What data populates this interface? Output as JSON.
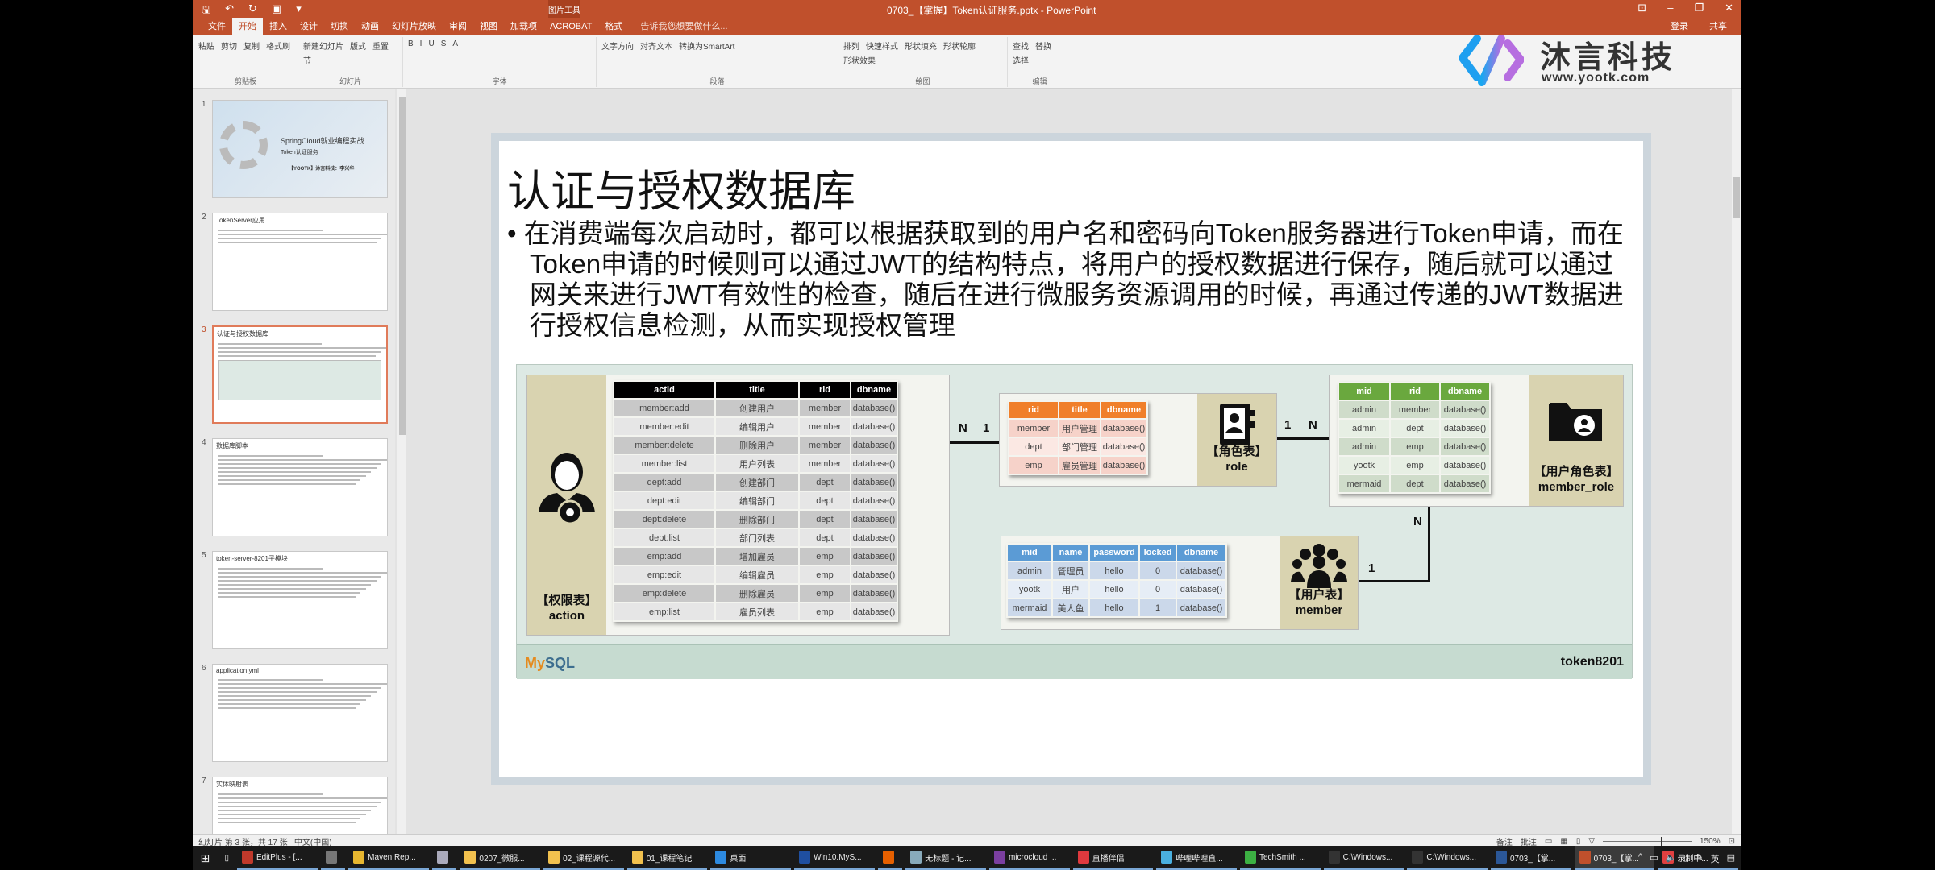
{
  "titlebar": {
    "title": "0703_【掌握】Token认证服务.pptx - PowerPoint",
    "context_tool": "图片工具",
    "qat": [
      "save-icon",
      "undo-icon",
      "redo-icon",
      "present-icon",
      "customize-icon"
    ]
  },
  "tabs": [
    "文件",
    "开始",
    "插入",
    "设计",
    "切换",
    "动画",
    "幻灯片放映",
    "审阅",
    "视图",
    "加载项",
    "ACROBAT",
    "格式"
  ],
  "active_tab": "开始",
  "tell_me": "告诉我您想要做什么...",
  "account": {
    "login": "登录",
    "share": "共享"
  },
  "ribbon": {
    "groups": [
      {
        "label": "剪贴板",
        "items": [
          "粘贴",
          "剪切",
          "复制",
          "格式刷"
        ]
      },
      {
        "label": "幻灯片",
        "items": [
          "新建幻灯片",
          "版式",
          "重置",
          "节"
        ]
      },
      {
        "label": "字体",
        "items": [
          "B",
          "I",
          "U",
          "S",
          "A"
        ]
      },
      {
        "label": "段落",
        "items": [
          "文字方向",
          "对齐文本",
          "转换为SmartArt"
        ]
      },
      {
        "label": "绘图",
        "items": [
          "排列",
          "快速样式",
          "形状填充",
          "形状轮廓",
          "形状效果"
        ]
      },
      {
        "label": "编辑",
        "items": [
          "查找",
          "替换",
          "选择"
        ]
      }
    ]
  },
  "watermark": {
    "name": "沐言科技",
    "url": "www.yootk.com"
  },
  "thumbnails": [
    {
      "num": "1",
      "title": "SpringCloud就业编程实战",
      "sub": "Token认证服务",
      "author": "【YOOTK】沐言科技：李兴华"
    },
    {
      "num": "2",
      "title": "TokenServer应用"
    },
    {
      "num": "3",
      "title": "认证与授权数据库",
      "selected": true
    },
    {
      "num": "4",
      "title": "数据库脚本"
    },
    {
      "num": "5",
      "title": "token-server-8201子模块"
    },
    {
      "num": "6",
      "title": "application.yml"
    },
    {
      "num": "7",
      "title": "实体映射表"
    }
  ],
  "slide": {
    "title": "认证与授权数据库",
    "body": "• 在消费端每次启动时，都可以根据获取到的用户名和密码向Token服务器进行Token申请，而在Token申请的时候则可以通过JWT的结构特点，将用户的授权数据进行保存，随后就可以通过网关来进行JWT有效性的检查，随后在进行微服务资源调用的时候，再通过传递的JWT数据进行授权信息检测，从而实现授权管理",
    "db_name": "token8201",
    "mysql_logo": "MySQL",
    "relations": {
      "action_role": [
        "N",
        "1"
      ],
      "role_member_role": [
        "1",
        "N"
      ],
      "member_role_member": [
        "N",
        "1"
      ]
    },
    "tables": {
      "action": {
        "label_cn": "【权限表】",
        "label_en": "action",
        "header_color": "#000000",
        "row_colors": [
          "#c8c8c8",
          "#e6e6e6"
        ],
        "columns": [
          "actid",
          "title",
          "rid",
          "dbname"
        ],
        "rows": [
          [
            "member:add",
            "创建用户",
            "member",
            "database()"
          ],
          [
            "member:edit",
            "编辑用户",
            "member",
            "database()"
          ],
          [
            "member:delete",
            "删除用户",
            "member",
            "database()"
          ],
          [
            "member:list",
            "用户列表",
            "member",
            "database()"
          ],
          [
            "dept:add",
            "创建部门",
            "dept",
            "database()"
          ],
          [
            "dept:edit",
            "编辑部门",
            "dept",
            "database()"
          ],
          [
            "dept:delete",
            "删除部门",
            "dept",
            "database()"
          ],
          [
            "dept:list",
            "部门列表",
            "dept",
            "database()"
          ],
          [
            "emp:add",
            "增加雇员",
            "emp",
            "database()"
          ],
          [
            "emp:edit",
            "编辑雇员",
            "emp",
            "database()"
          ],
          [
            "emp:delete",
            "删除雇员",
            "emp",
            "database()"
          ],
          [
            "emp:list",
            "雇员列表",
            "emp",
            "database()"
          ]
        ]
      },
      "role": {
        "label_cn": "【角色表】",
        "label_en": "role",
        "header_color": "#f07f2a",
        "row_colors": [
          "#f6d2c9",
          "#fbe8e3"
        ],
        "columns": [
          "rid",
          "title",
          "dbname"
        ],
        "rows": [
          [
            "member",
            "用户管理",
            "database()"
          ],
          [
            "dept",
            "部门管理",
            "database()"
          ],
          [
            "emp",
            "雇员管理",
            "database()"
          ]
        ]
      },
      "member_role": {
        "label_cn": "【用户角色表】",
        "label_en": "member_role",
        "header_color": "#6aa83e",
        "row_colors": [
          "#cfdcca",
          "#e7efe4"
        ],
        "columns": [
          "mid",
          "rid",
          "dbname"
        ],
        "rows": [
          [
            "admin",
            "member",
            "database()"
          ],
          [
            "admin",
            "dept",
            "database()"
          ],
          [
            "admin",
            "emp",
            "database()"
          ],
          [
            "yootk",
            "emp",
            "database()"
          ],
          [
            "mermaid",
            "dept",
            "database()"
          ]
        ]
      },
      "member": {
        "label_cn": "【用户表】",
        "label_en": "member",
        "header_color": "#5b9bd5",
        "row_colors": [
          "#cbd8ea",
          "#e6edf6"
        ],
        "columns": [
          "mid",
          "name",
          "password",
          "locked",
          "dbname"
        ],
        "rows": [
          [
            "admin",
            "管理员",
            "hello",
            "0",
            "database()"
          ],
          [
            "yootk",
            "用户",
            "hello",
            "0",
            "database()"
          ],
          [
            "mermaid",
            "美人鱼",
            "hello",
            "1",
            "database()"
          ]
        ]
      }
    }
  },
  "statusbar": {
    "slide_info": "幻灯片 第 3 张，共 17 张",
    "language": "中文(中国)",
    "notes": "备注",
    "comments": "批注",
    "zoom": "150%",
    "zoom_percent": 150
  },
  "taskbar": {
    "items": [
      {
        "label": "EditPlus - [...",
        "color": "#c0392b"
      },
      {
        "label": "",
        "color": "#777"
      },
      {
        "label": "Maven Rep...",
        "color": "#e8b730"
      },
      {
        "label": "",
        "color": "#aab"
      },
      {
        "label": "0207_微服...",
        "color": "#f2c14e"
      },
      {
        "label": "02_课程源代...",
        "color": "#f2c14e"
      },
      {
        "label": "01_课程笔记",
        "color": "#f2c14e"
      },
      {
        "label": "桌面",
        "color": "#2d8ae0"
      },
      {
        "label": "Win10.MyS...",
        "color": "#1f4fa0"
      },
      {
        "label": "",
        "color": "#e66000"
      },
      {
        "label": "无标题 - 记...",
        "color": "#8ab"
      },
      {
        "label": "microcloud ...",
        "color": "#7b3fa0"
      },
      {
        "label": "直播伴侣",
        "color": "#e0393e"
      },
      {
        "label": "哔哩哔哩直...",
        "color": "#4ab0e0"
      },
      {
        "label": "TechSmith ...",
        "color": "#3cb043"
      },
      {
        "label": "C:\\Windows...",
        "color": "#333"
      },
      {
        "label": "C:\\Windows...",
        "color": "#333"
      },
      {
        "label": "0703_【掌...",
        "color": "#2b5797"
      },
      {
        "label": "0703_【掌...",
        "color": "#c0502c",
        "active": true
      },
      {
        "label": "录制中...",
        "color": "#e04040"
      }
    ],
    "tray": [
      "^",
      "network-icon",
      "volume-icon",
      "tablet-icon",
      "pen-icon",
      "英",
      "notification-icon"
    ]
  }
}
